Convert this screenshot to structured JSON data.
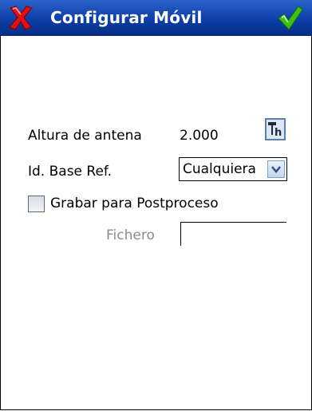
{
  "window": {
    "title": "Configurar Móvil"
  },
  "icons": {
    "cancel": "red-x-icon",
    "ok": "green-check-icon",
    "antenna": "antenna-height-icon",
    "dropdown": "chevron-down-icon"
  },
  "form": {
    "antenna_label": "Altura de antena",
    "antenna_value": "2.000",
    "base_label": "Id. Base Ref.",
    "base_selected": "Cualquiera",
    "postprocess_label": "Grabar para Postproceso",
    "postprocess_checked": false,
    "file_label": "Fichero",
    "file_value": ""
  },
  "colors": {
    "title_bar": "#0d3fa8",
    "cancel": "#e01010",
    "ok": "#3cc10f"
  }
}
